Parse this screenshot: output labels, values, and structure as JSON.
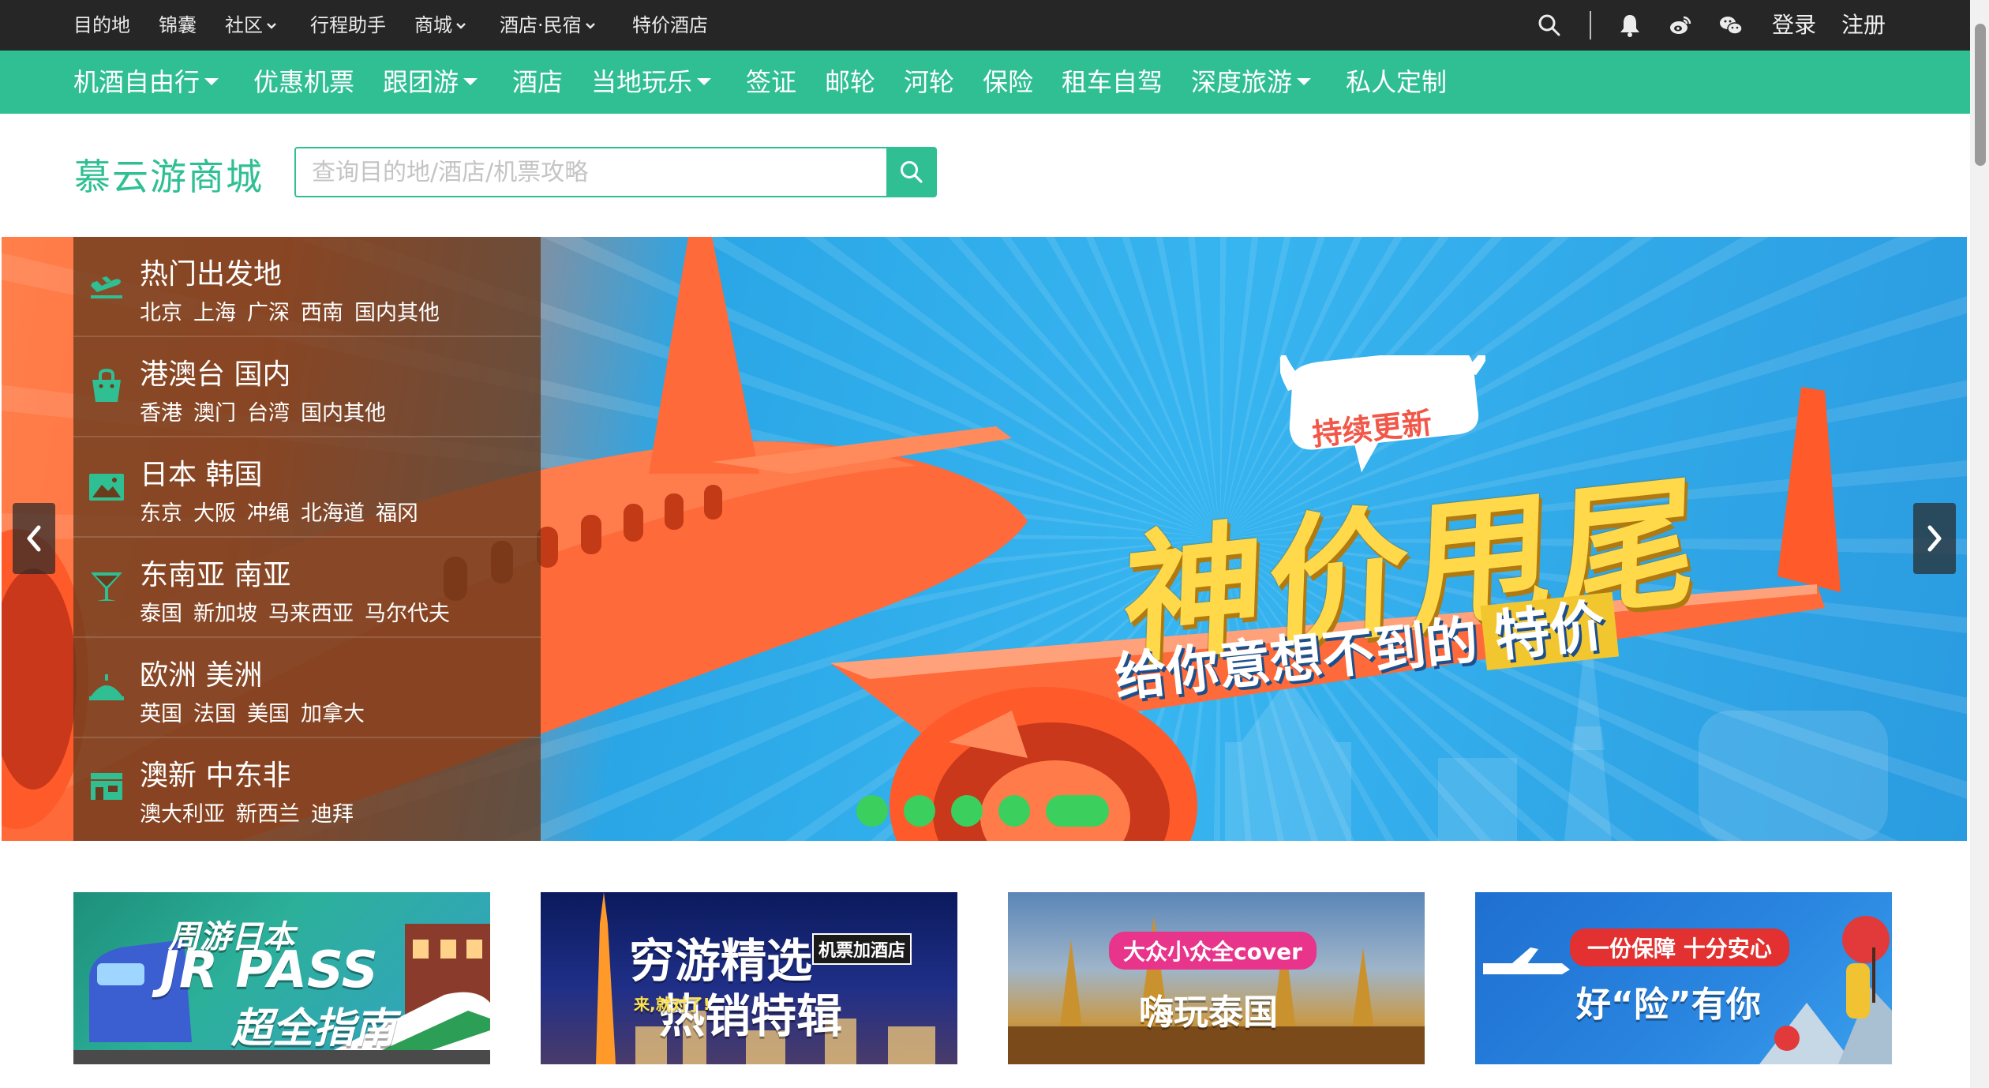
{
  "topbar": {
    "links": [
      {
        "label": "目的地",
        "dropdown": false
      },
      {
        "label": "锦囊",
        "dropdown": false
      },
      {
        "label": "社区",
        "dropdown": true
      },
      {
        "label": "行程助手",
        "dropdown": false
      },
      {
        "label": "商城",
        "dropdown": true
      },
      {
        "label": "酒店·民宿",
        "dropdown": true
      },
      {
        "label": "特价酒店",
        "dropdown": false
      }
    ],
    "icons": [
      "search-icon",
      "bell-icon",
      "weibo-icon",
      "wechat-icon"
    ],
    "login": "登录",
    "register": "注册"
  },
  "nav": {
    "items": [
      {
        "label": "机酒自由行",
        "dropdown": true
      },
      {
        "label": "优惠机票",
        "dropdown": false
      },
      {
        "label": "跟团游",
        "dropdown": true
      },
      {
        "label": "酒店",
        "dropdown": false
      },
      {
        "label": "当地玩乐",
        "dropdown": true
      },
      {
        "label": "签证",
        "dropdown": false
      },
      {
        "label": "邮轮",
        "dropdown": false
      },
      {
        "label": "河轮",
        "dropdown": false
      },
      {
        "label": "保险",
        "dropdown": false
      },
      {
        "label": "租车自驾",
        "dropdown": false
      },
      {
        "label": "深度旅游",
        "dropdown": true
      },
      {
        "label": "私人定制",
        "dropdown": false
      }
    ]
  },
  "brand": "慕云游商城",
  "search": {
    "placeholder": "查询目的地/酒店/机票攻略",
    "value": ""
  },
  "categories": [
    {
      "title": "热门出发地",
      "icon": "plane-takeoff-icon",
      "subs": [
        "北京",
        "上海",
        "广深",
        "西南",
        "国内其他"
      ]
    },
    {
      "title": "港澳台 国内",
      "icon": "shopping-bag-icon",
      "subs": [
        "香港",
        "澳门",
        "台湾",
        "国内其他"
      ]
    },
    {
      "title": "日本 韩国",
      "icon": "landscape-icon",
      "subs": [
        "东京",
        "大阪",
        "冲绳",
        "北海道",
        "福冈"
      ]
    },
    {
      "title": "东南亚 南亚",
      "icon": "cocktail-icon",
      "subs": [
        "泰国",
        "新加坡",
        "马来西亚",
        "马尔代夫"
      ]
    },
    {
      "title": "欧洲 美洲",
      "icon": "landmark-icon",
      "subs": [
        "英国",
        "法国",
        "美国",
        "加拿大"
      ]
    },
    {
      "title": "澳新 中东非",
      "icon": "store-icon",
      "subs": [
        "澳大利亚",
        "新西兰",
        "迪拜"
      ]
    }
  ],
  "banner": {
    "badge": "持续更新",
    "headline": "神价甩尾",
    "subline_prefix": "给你意想不到的",
    "subline_highlight": "特价",
    "slide_count": 5,
    "active_slide": 5
  },
  "promos": [
    {
      "line1": "周游日本",
      "line2": "JR PASS",
      "line3": "超全指南"
    },
    {
      "tag": "机票加酒店",
      "line1": "穷游精选",
      "line2": "热销特辑",
      "line3": "来,就对了!"
    },
    {
      "tag": "大众小众全cover",
      "line1": "嗨玩泰国"
    },
    {
      "tag": "一份保障 十分安心",
      "line1": "好“险”有你"
    }
  ],
  "colors": {
    "brand": "#2fbf93",
    "topbar": "#262626",
    "dots": "#3bcf5e"
  }
}
